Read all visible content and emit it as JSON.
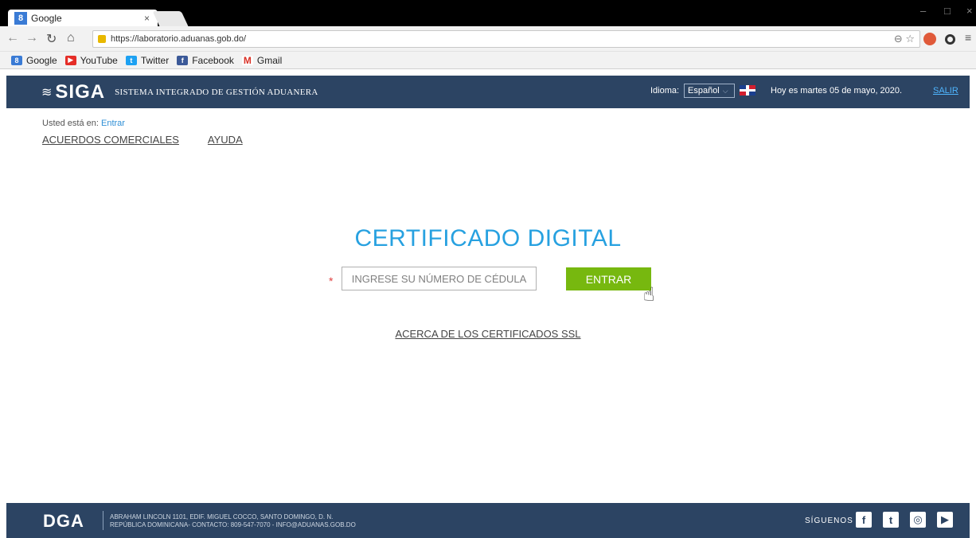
{
  "browser": {
    "tab_title": "Google",
    "tab_close": "×",
    "favicon": "8",
    "url": "https://laboratorio.aduanas.gob.do/",
    "bookmarks": [
      {
        "label": "Google",
        "icon": "google-icon",
        "color": "#3a7bd5"
      },
      {
        "label": "YouTube",
        "icon": "youtube-icon",
        "color": "#e52d27"
      },
      {
        "label": "Twitter",
        "icon": "twitter-icon",
        "color": "#1da1f2"
      },
      {
        "label": "Facebook",
        "icon": "facebook-icon",
        "color": "#3b5998"
      },
      {
        "label": "Gmail",
        "icon": "gmail-icon",
        "color": "#d93025"
      }
    ]
  },
  "header": {
    "logo": "SIGA",
    "system_name": "SISTEMA INTEGRADO DE GESTIÓN ADUANERA",
    "idioma_label": "Idioma:",
    "language": "Español",
    "date_text": "Hoy es martes 05 de mayo, 2020.",
    "logout": "SALIR",
    "bg_color": "#2c4463"
  },
  "breadcrumb": {
    "prefix": "Usted está en: ",
    "current": "Entrar"
  },
  "nav": {
    "items": [
      "ACUERDOS COMERCIALES",
      "AYUDA"
    ]
  },
  "login": {
    "title": "CERTIFICADO DIGITAL",
    "required_mark": "*",
    "cedula_placeholder": "INGRESE SU NÚMERO DE CÉDULA",
    "submit_label": "ENTRAR",
    "ssl_link": "ACERCA DE LOS CERTIFICADOS SSL",
    "accent": "#27a1e0",
    "button_color": "#77b80f"
  },
  "footer": {
    "logo": "DGA",
    "address_line1": "ABRAHAM LINCOLN 1101, EDIF. MIGUEL COCCO, SANTO DOMINGO, D. N.",
    "address_line2": "REPÚBLICA DOMINICANA- CONTACTO: 809-547-7070 - INFO@ADUANAS.GOB.DO",
    "follow_label": "SÍGUENOS",
    "social": [
      "facebook-icon",
      "twitter-icon",
      "instagram-icon",
      "youtube-icon"
    ]
  }
}
